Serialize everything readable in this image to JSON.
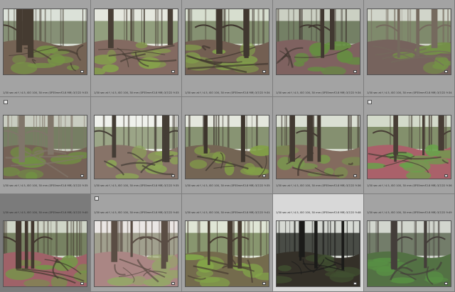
{
  "grid": {
    "cells": [
      {
        "row": 1,
        "meta": "1/30 sec at f / 4.5, ISO 100, 30 mm (SP35mmF2.8 MR)   3/7/22 9:33:22 AM",
        "selected": false,
        "badge": false,
        "palette": "forest-moss-a"
      },
      {
        "row": 1,
        "meta": "1/30 sec at f / 4.5, ISO 100, 30 mm (SP35mmF2.8 MR)   3/7/22 9:33:44 AM",
        "selected": false,
        "badge": false,
        "palette": "forest-moss-b"
      },
      {
        "row": 1,
        "meta": "1/30 sec at f / 4.5, ISO 100, 30 mm (SP35mmF2.8 MR)   3/7/22 9:34:06 AM",
        "selected": false,
        "badge": false,
        "palette": "forest-moss-c"
      },
      {
        "row": 1,
        "meta": "1/30 sec at f / 4.5, ISO 100, 30 mm (SP35mmF2.8 MR)   3/7/22 9:34:28 AM",
        "selected": false,
        "badge": false,
        "palette": "forest-fern"
      },
      {
        "row": 1,
        "meta": "1/30 sec at f / 4.5, ISO 100, 30 mm (SP35mmF2.8 MR)   3/7/22 9:34:51 AM",
        "selected": false,
        "badge": false,
        "palette": "forest-trunk"
      },
      {
        "row": 2,
        "meta": "1/30 sec at f / 4.5, ISO 100, 30 mm (SP35mmF2.8 MR)   3/7/22 9:35:10 AM",
        "selected": false,
        "badge": true,
        "palette": "forest-trunk-close"
      },
      {
        "row": 2,
        "meta": "1/30 sec at f / 4.5, ISO 100, 30 mm (SP35mmF2.8 MR)   3/7/22 9:35:33 AM",
        "selected": false,
        "badge": false,
        "palette": "forest-bright"
      },
      {
        "row": 2,
        "meta": "1/30 sec at f / 4.5, ISO 100, 30 mm (SP35mmF2.8 MR)   3/7/22 9:35:58 AM",
        "selected": false,
        "badge": false,
        "palette": "forest-moss-mound"
      },
      {
        "row": 2,
        "meta": "1/30 sec at f / 4.5, ISO 100, 30 mm (SP35mmF2.8 MR)   3/7/22 9:36:20 AM",
        "selected": false,
        "badge": false,
        "palette": "forest-roots"
      },
      {
        "row": 2,
        "meta": "1/30 sec at f / 4.5, ISO 100, 30 mm (SP35mmF2.8 MR)   3/7/22 9:36:44 AM",
        "selected": false,
        "badge": true,
        "palette": "forest-red"
      },
      {
        "row": 3,
        "meta": "1/30 sec at f / 4.5, ISO 100, 30 mm (SP35mmF2.8 MR)   3/7/22 9:40:02 AM",
        "selected": false,
        "dim": true,
        "badge": false,
        "palette": "forest-red-2"
      },
      {
        "row": 3,
        "meta": "1/30 sec at f / 4.5, ISO 100, 30 mm (SP35mmF2.8 MR)   3/7/22 9:40:30 AM",
        "selected": false,
        "badge": true,
        "palette": "forest-pale"
      },
      {
        "row": 3,
        "meta": "1/30 sec at f / 4.5, ISO 100, 30 mm (SP35mmF2.8 MR)   3/7/22 9:41:05 AM",
        "selected": false,
        "badge": false,
        "palette": "forest-arch"
      },
      {
        "row": 3,
        "meta": "1/30 sec at f / 4.5, ISO 100, 30 mm (SP35mmF2.8 MR)   3/7/22 9:48:22 AM",
        "selected": true,
        "badge": false,
        "palette": "forest-dark"
      },
      {
        "row": 3,
        "meta": "1/30 sec at f / 4.5, ISO 100, 30 mm (SP35mmF2.8 MR)   3/7/22 9:49:10 AM",
        "selected": false,
        "badge": false,
        "palette": "forest-green-floor"
      }
    ]
  },
  "colors": {
    "cell_bg": "#a3a3a3",
    "cell_selected_bg": "#d8d8d8",
    "cell_dim_bg": "#7b7b7b"
  }
}
